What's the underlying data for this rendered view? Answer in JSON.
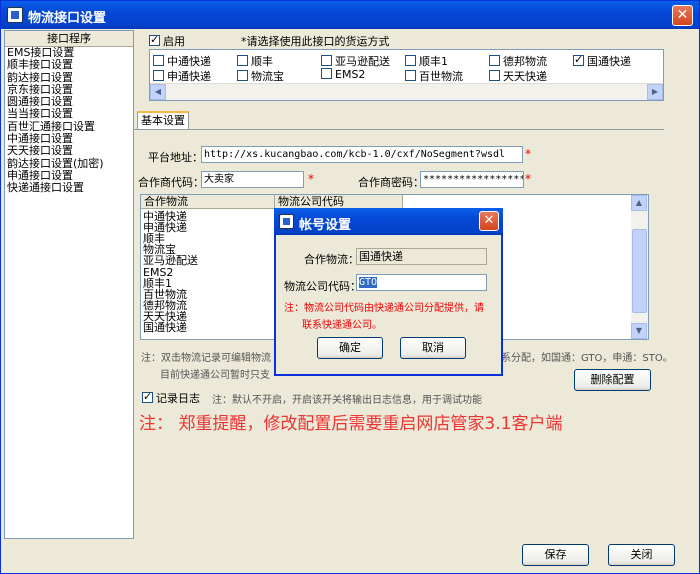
{
  "window": {
    "title": "物流接口设置"
  },
  "left_panel": {
    "header": "接口程序",
    "items": [
      "EMS接口设置",
      "顺丰接口设置",
      "韵达接口设置",
      "京东接口设置",
      "圆通接口设置",
      "当当接口设置",
      "百世汇通接口设置",
      "中通接口设置",
      "天天接口设置",
      "韵达接口设置(加密)",
      "申通接口设置",
      "快递通接口设置"
    ]
  },
  "enable": {
    "label": "启用",
    "checked": true,
    "hint": "*请选择使用此接口的货运方式"
  },
  "shipping": [
    {
      "label": "中通快递",
      "checked": false
    },
    {
      "label": "顺丰",
      "checked": false
    },
    {
      "label": "亚马逊配送",
      "checked": false
    },
    {
      "label": "顺丰1",
      "checked": false
    },
    {
      "label": "德邦物流",
      "checked": false
    },
    {
      "label": "国通快递",
      "checked": true
    },
    {
      "label": "申通快递",
      "checked": false
    },
    {
      "label": "物流宝",
      "checked": false
    },
    {
      "label": "EMS2",
      "checked": false
    },
    {
      "label": "百世物流",
      "checked": false
    },
    {
      "label": "天天快递",
      "checked": false
    }
  ],
  "tab": {
    "label": "基本设置"
  },
  "form": {
    "platform_label": "平台地址：",
    "platform_value": "http://xs.kucangbao.com/kcb-1.0/cxf/NoSegment?wsdl",
    "partner_code_label": "合作商代码：",
    "partner_code_value": "大卖家",
    "partner_pwd_label": "合作商密码：",
    "partner_pwd_value": "********************",
    "required_mark": "*"
  },
  "grid": {
    "col1": "合作物流",
    "col2": "物流公司代码",
    "rows": [
      "中通快递",
      "申通快递",
      "顺丰",
      "物流宝",
      "亚马逊配送",
      "EMS2",
      "顺丰1",
      "百世物流",
      "德邦物流",
      "天天快递",
      "国通快递"
    ]
  },
  "notes": {
    "note1_left": "注：双击物流记录可编辑物流",
    "note1_right": "系分配，如国通：GTO，申通：STO。",
    "note2": "目前快递通公司暂时只支"
  },
  "delete_button": "删除配置",
  "log": {
    "label": "记录日志",
    "checked": true,
    "hint": "注：默认不开启，开启该开关将输出日志信息，用于调试功能"
  },
  "warning": "注： 郑重提醒，修改配置后需要重启网店管家3.1客户端",
  "buttons": {
    "save": "保存",
    "close": "关闭"
  },
  "dialog": {
    "title": "帐号设置",
    "partner_label": "合作物流：",
    "partner_value": "国通快递",
    "code_label": "物流公司代码：",
    "code_value": "GTO",
    "note_line1": "注：物流公司代码由快递通公司分配提供，请",
    "note_line2": "联系快递通公司。",
    "ok": "确定",
    "cancel": "取消"
  }
}
